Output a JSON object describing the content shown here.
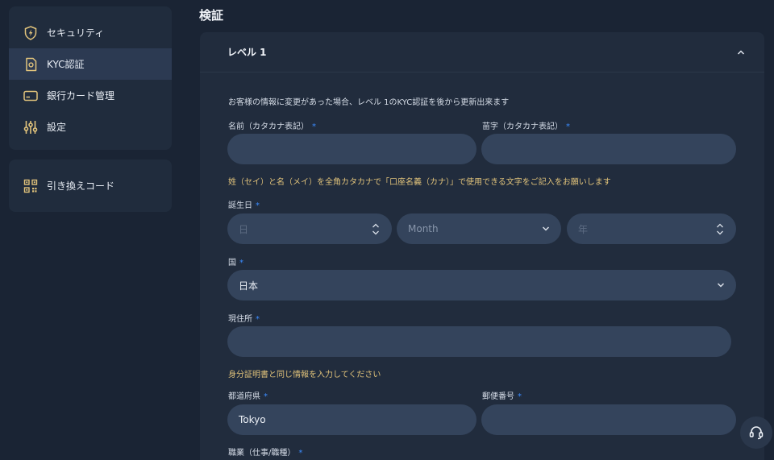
{
  "sidebar": {
    "items": [
      {
        "label": "セキュリティ",
        "icon": "shield-bolt-icon"
      },
      {
        "label": "KYC認証",
        "icon": "id-document-icon"
      },
      {
        "label": "銀行カード管理",
        "icon": "credit-card-icon"
      },
      {
        "label": "設定",
        "icon": "sliders-icon"
      }
    ],
    "bottom_items": [
      {
        "label": "引き換えコード",
        "icon": "qr-code-icon"
      }
    ]
  },
  "page": {
    "title": "検証"
  },
  "level_panel": {
    "title": "レベル 1",
    "intro": "お客様の情報に変更があった場合、レベル 1のKYC認証を後から更新出来ます",
    "first_name_label": "名前（カタカナ表記）",
    "last_name_label": "苗字（カタカナ表記）",
    "first_name_value": "",
    "last_name_value": "",
    "katakana_note": "姓（セイ）と名（メイ）を全角カタカナで「口座名義（カナ）」で使用できる文字をご記入をお願いします",
    "birthdate_label": "誕生日",
    "day_placeholder": "日",
    "month_placeholder": "Month",
    "year_placeholder": "年",
    "country_label": "国",
    "country_value": "日本",
    "address_label": "現住所",
    "address_value": "",
    "id_note": "身分証明書と同じ情報を入力してください",
    "prefecture_label": "都道府県",
    "prefecture_value": "Tokyo",
    "postal_label": "郵便番号",
    "postal_value": "",
    "occupation_label": "職業（仕事/職種）",
    "required_mark": "*"
  },
  "colors": {
    "background": "#1a2434",
    "panel": "#212c3d",
    "field": "#34445c",
    "required": "#3b8cff",
    "note": "#e0c27a",
    "icon_gold": "#e2c47c"
  }
}
